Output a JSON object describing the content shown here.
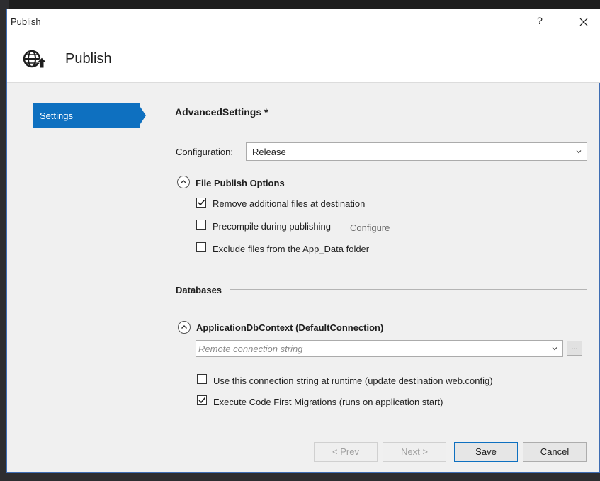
{
  "window": {
    "title": "Publish",
    "help_label": "?"
  },
  "header": {
    "title": "Publish",
    "icon": "globe-publish-icon"
  },
  "sidebar": {
    "items": [
      {
        "label": "Settings",
        "selected": true
      }
    ]
  },
  "main": {
    "section_title": "AdvancedSettings *",
    "configuration": {
      "label": "Configuration:",
      "value": "Release"
    },
    "file_publish_options": {
      "title": "File Publish Options",
      "options": [
        {
          "label": "Remove additional files at destination",
          "checked": true
        },
        {
          "label": "Precompile during publishing",
          "checked": false,
          "link": "Configure"
        },
        {
          "label": "Exclude files from the App_Data folder",
          "checked": false
        }
      ]
    },
    "databases": {
      "heading": "Databases",
      "context": {
        "title": "ApplicationDbContext (DefaultConnection)",
        "connection_placeholder": "Remote connection string",
        "ellipsis": "...",
        "options": [
          {
            "label": "Use this connection string at runtime (update destination web.config)",
            "checked": false
          },
          {
            "label": "Execute Code First Migrations (runs on application start)",
            "checked": true
          }
        ]
      }
    }
  },
  "footer": {
    "prev_label": "< Prev",
    "next_label": "Next >",
    "save_label": "Save",
    "cancel_label": "Cancel"
  },
  "colors": {
    "accent": "#0e70c0",
    "dialog_bg": "#f0f0f0"
  }
}
